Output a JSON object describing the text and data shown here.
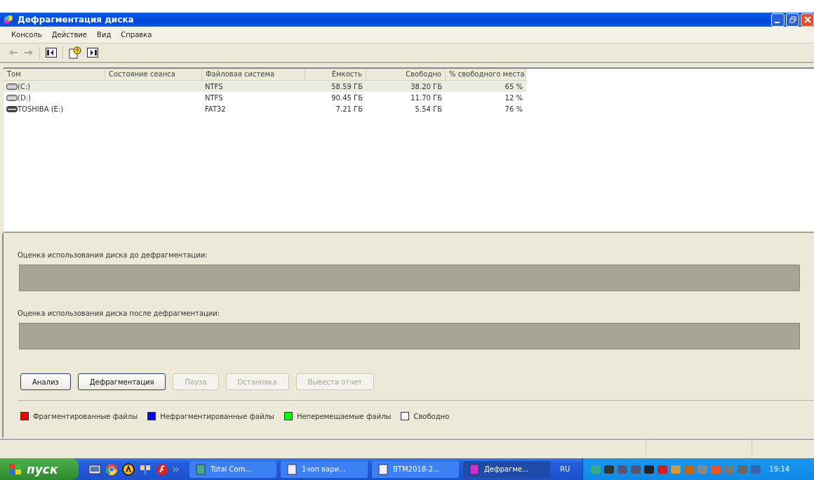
{
  "window": {
    "title": "Дефрагментация диска"
  },
  "menu": [
    "Консоль",
    "Действие",
    "Вид",
    "Справка"
  ],
  "table": {
    "columns": [
      "Том",
      "Состояние сеанса",
      "Файловая система",
      "Емкость",
      "Свободно",
      "% свободного места"
    ],
    "rows": [
      {
        "selected": true,
        "cells": [
          "(C:)",
          "",
          "NTFS",
          "58.59 ГБ",
          "38.20 ГБ",
          "65 %"
        ]
      },
      {
        "selected": false,
        "cells": [
          "(D:)",
          "",
          "NTFS",
          "90.45 ГБ",
          "11.70 ГБ",
          "12 %"
        ]
      },
      {
        "selected": false,
        "cells": [
          "TOSHIBA (E:)",
          "",
          "FAT32",
          "7.21 ГБ",
          "5.54 ГБ",
          "76 %"
        ]
      }
    ]
  },
  "before": {
    "label": "Оценка использования диска до дефрагментации:"
  },
  "after": {
    "label": "Оценка использования диска после дефрагментации:"
  },
  "buttons": [
    {
      "label": "Анализ",
      "disabled": false
    },
    {
      "label": "Дефрагментация",
      "disabled": false
    },
    {
      "label": "Пауза",
      "disabled": true
    },
    {
      "label": "Остановка",
      "disabled": true
    },
    {
      "label": "Вывести отчет",
      "disabled": true
    }
  ],
  "legend": [
    {
      "label": "Фрагментированные файлы",
      "color": "#ff0000"
    },
    {
      "label": "Нефрагментированные файлы",
      "color": "#0000ff"
    },
    {
      "label": "Неперемещаемые файлы",
      "color": "#00ff00"
    },
    {
      "label": "Свободно",
      "color": "#ffffff"
    }
  ],
  "taskbar": {
    "start": "пуск",
    "tasks": [
      {
        "label": "Total Com...",
        "selected": false
      },
      {
        "label": "1чоп вари...",
        "selected": false
      },
      {
        "label": "BTM2018-2...",
        "selected": false
      },
      {
        "label": "Дефрагме...",
        "selected": true
      }
    ],
    "lang": "RU",
    "clock": "19:14"
  }
}
